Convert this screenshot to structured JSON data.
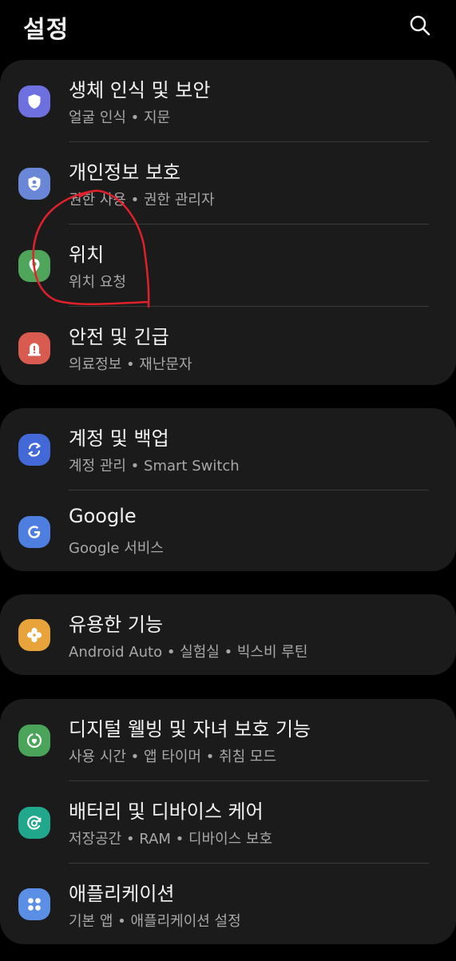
{
  "header": {
    "title": "설정",
    "search_icon": "search-icon"
  },
  "groups": [
    {
      "items": [
        {
          "title": "생체 인식 및 보안",
          "subtitle": "얼굴 인식 • 지문",
          "icon": "shield-icon",
          "color": "#6e70e0"
        },
        {
          "title": "개인정보 보호",
          "subtitle": "권한 사용 • 권한 관리자",
          "icon": "privacy-icon",
          "color": "#6a86d6"
        },
        {
          "title": "위치",
          "subtitle": "위치 요청",
          "icon": "location-pin-icon",
          "color": "#4fa65a"
        },
        {
          "title": "안전 및 긴급",
          "subtitle": "의료정보 • 재난문자",
          "icon": "emergency-icon",
          "color": "#d95b4f"
        }
      ]
    },
    {
      "items": [
        {
          "title": "계정 및 백업",
          "subtitle": "계정 관리 • Smart Switch",
          "icon": "sync-icon",
          "color": "#4369d8"
        },
        {
          "title": "Google",
          "subtitle": "Google 서비스",
          "icon": "google-icon",
          "color": "#4e7fe0"
        }
      ]
    },
    {
      "items": [
        {
          "title": "유용한 기능",
          "subtitle": "Android Auto • 실험실 • 빅스비 루틴",
          "icon": "advanced-features-icon",
          "color": "#e8a33a"
        }
      ]
    },
    {
      "items": [
        {
          "title": "디지털 웰빙 및 자녀 보호 기능",
          "subtitle": "사용 시간 • 앱 타이머 • 취침 모드",
          "icon": "wellbeing-icon",
          "color": "#4aa55a"
        },
        {
          "title": "배터리 및 디바이스 케어",
          "subtitle": "저장공간 • RAM • 디바이스 보호",
          "icon": "device-care-icon",
          "color": "#21a88c"
        },
        {
          "title": "애플리케이션",
          "subtitle": "기본 앱 • 애플리케이션 설정",
          "icon": "apps-grid-icon",
          "color": "#5b8fe6"
        }
      ]
    }
  ],
  "colors": {
    "background": "#000000",
    "card": "#1b1b1b",
    "annotation": "#e0202a"
  }
}
